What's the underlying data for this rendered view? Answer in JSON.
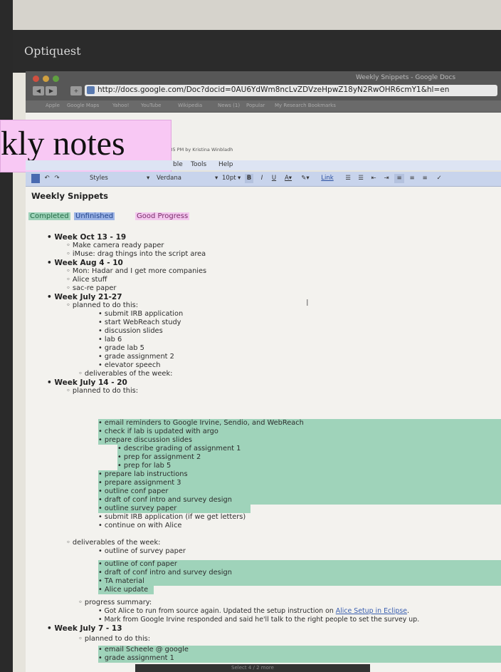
{
  "monitor": {
    "brand": "Optiquest"
  },
  "browser": {
    "window_title": "Weekly Snippets - Google Docs",
    "url": "http://docs.google.com/Doc?docid=0AU6YdWm8ncLvZDVzeHpwZ18yN2RwOHR6cmY1&hl=en",
    "bookmarks": [
      "Apple",
      "Google Maps",
      "Yahoo!",
      "YouTube",
      "Wikipedia",
      "News (1)",
      "Popular",
      "My Research Bookmarks"
    ]
  },
  "overlay_label": "kly notes",
  "doc": {
    "edited_info": "4:35 PM by Kristina Winbladh",
    "menu": [
      "ble",
      "Tools",
      "Help"
    ],
    "toolbar": {
      "styles": "Styles",
      "font": "Verdana",
      "size": "10pt",
      "bold": "B",
      "italic": "I",
      "underline": "U",
      "link": "Link"
    },
    "title": "Weekly Snippets",
    "legend": {
      "completed": "Completed",
      "unfinished": "Unfinished",
      "good": "Good Progress"
    },
    "lines": [
      "Week Oct 13 - 19",
      "Make camera ready paper",
      "iMuse: drag things into the script area",
      "Week Aug 4 - 10",
      "Mon: Hadar and I get more companies",
      "Alice stuff",
      "sac-re paper",
      "Week July 21-27",
      "planned to do this:",
      "submit IRB application",
      "start WebReach study",
      "discussion slides",
      "lab 6",
      "grade lab 5",
      "grade assignment 2",
      "elevator speech",
      "deliverables of the week:",
      "Week July 14 - 20",
      "planned to do this:",
      "email reminders to Google Irvine, Sendio, and WebReach",
      "check if lab is updated with argo",
      "prepare discussion slides",
      "describe grading of assignment 1",
      "prep for assignment 2",
      "prep for lab 5",
      "prepare lab instructions",
      "prepare assignment 3",
      "outline conf paper",
      "draft of conf intro and survey design",
      "outline survey paper",
      "submit IRB application (if we get letters)",
      "continue on with Alice",
      "deliverables of the week:",
      "outline of survey paper",
      "outline of conf paper",
      "draft of conf intro and survey design",
      "TA material",
      "Alice update",
      "progress summary:",
      "Got Alice to run from source again. Updated the setup instruction on ",
      "Mark from Google Irvine responded and said he'll talk to the right people to set the survey up.",
      "Week July 7 - 13",
      "planned to do this:",
      "email Scheele @ google",
      "grade assignment 1"
    ],
    "link_text": "Alice Setup in Eclipse",
    "status_text": "Select 4 / 2 more"
  },
  "colors": {
    "completed": "#9fd3ba",
    "unfinished": "#9cb4e6",
    "good": "#f3c8ee"
  }
}
